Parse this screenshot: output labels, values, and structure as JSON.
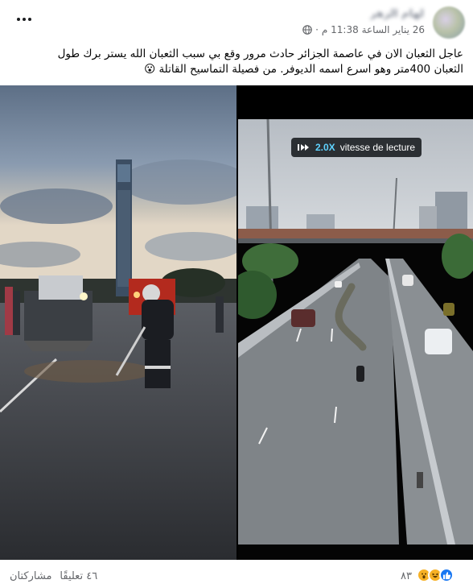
{
  "post": {
    "author": "إلهام الزهر",
    "date": "26 يناير الساعة 11:38 م",
    "separator": "·",
    "text_line1": "عاجل الثعبان الان في عاصمة الجزائر حادث مرور وقع بي سبب الثعبان  الله يستر برك طول",
    "text_line2": "الثعبان 400متر وهو اسرع اسمه الديوفر.  من فصيلة التماسيح القاتلة 😮"
  },
  "video": {
    "speed_value": "2.0X",
    "speed_label": "vitesse de lecture"
  },
  "footer": {
    "reaction_count": "٨٣",
    "comments": "٤٦ تعليقًا",
    "shares": "مشاركتان"
  },
  "colors": {
    "like_blue": "#1877f2",
    "haha_yellow": "#f7b125",
    "meta_gray": "#65676b"
  },
  "icons": {
    "privacy": "globe-icon",
    "menu": "more-icon",
    "reactions": [
      "like-icon",
      "haha-icon",
      "wow-icon"
    ]
  }
}
